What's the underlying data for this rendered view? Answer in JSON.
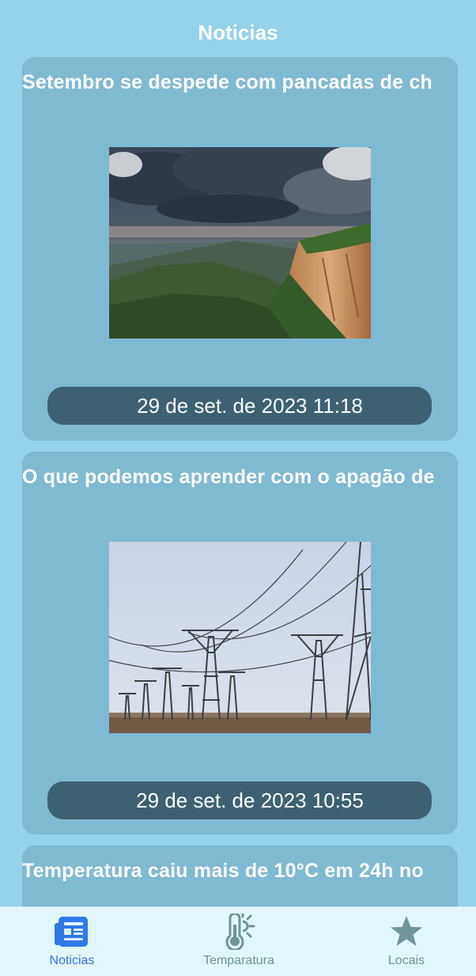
{
  "header": {
    "title": "Noticias"
  },
  "articles": [
    {
      "title": "Setembro se despede com pancadas de ch",
      "date": "29 de set. de 2023 11:18",
      "image": "storm-over-canyon"
    },
    {
      "title": "O que podemos aprender com o apagão de",
      "date": "29 de set. de 2023 10:55",
      "image": "power-transmission-towers"
    },
    {
      "title": "Temperatura caiu mais de 10°C em 24h no"
    }
  ],
  "tabs": [
    {
      "label": "Noticias",
      "icon": "newspaper-icon",
      "active": true
    },
    {
      "label": "Temparatura",
      "icon": "thermometer-sun-icon",
      "active": false
    },
    {
      "label": "Locais",
      "icon": "star-icon",
      "active": false
    }
  ],
  "colors": {
    "background": "#95d2ec",
    "card": "#7fbad3",
    "date_pill": "#3d6171",
    "tab_active": "#2f79e8",
    "tab_inactive": "#6e9599",
    "tabbar": "#e2f7fb"
  }
}
